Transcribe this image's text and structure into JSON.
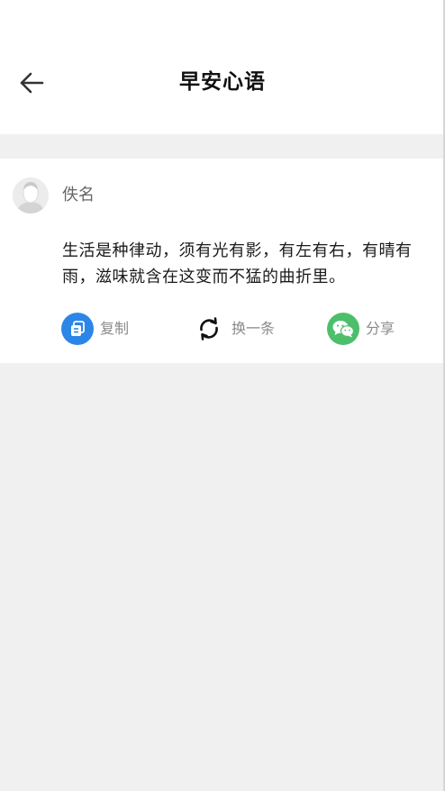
{
  "header": {
    "title": "早安心语"
  },
  "card": {
    "author": "佚名",
    "quote": "生活是种律动，须有光有影，有左有右，有晴有雨，滋味就含在这变而不猛的曲折里。"
  },
  "actions": {
    "copy_label": "复制",
    "refresh_label": "换一条",
    "share_label": "分享"
  },
  "icons": {
    "back": "arrow-left-icon",
    "avatar": "default-avatar-icon",
    "copy": "copy-icon",
    "refresh": "refresh-icon",
    "share": "wechat-icon"
  },
  "colors": {
    "background": "#f0f0f0",
    "card": "#ffffff",
    "copy_icon_bg": "#2b86e8",
    "share_icon_bg": "#4cbf6b",
    "text_primary": "#1a1a1a",
    "text_secondary": "#8a8a8a"
  }
}
